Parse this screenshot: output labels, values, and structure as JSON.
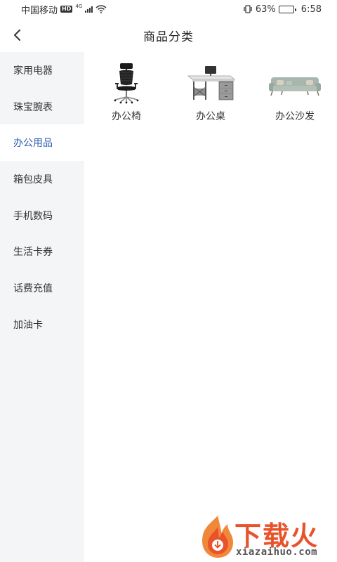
{
  "status_bar": {
    "carrier": "中国移动",
    "hd": "HD",
    "network": "4G",
    "battery_percent": "63%",
    "battery_level": 0.63,
    "time": "6:58"
  },
  "header": {
    "title": "商品分类"
  },
  "sidebar": {
    "items": [
      {
        "label": "家用电器"
      },
      {
        "label": "珠宝腕表"
      },
      {
        "label": "办公用品"
      },
      {
        "label": "箱包皮具"
      },
      {
        "label": "手机数码"
      },
      {
        "label": "生活卡券"
      },
      {
        "label": "话费充值"
      },
      {
        "label": "加油卡"
      }
    ],
    "active_index": 2
  },
  "products": [
    {
      "label": "办公椅",
      "icon": "office-chair-image"
    },
    {
      "label": "办公桌",
      "icon": "office-desk-image"
    },
    {
      "label": "办公沙发",
      "icon": "office-sofa-image"
    }
  ],
  "watermark": {
    "text": "下载火",
    "url": "xiazaihuo.com"
  },
  "colors": {
    "accent": "#2c5dad",
    "sidebar_bg": "#f4f5f7",
    "watermark": "#e8532b"
  }
}
